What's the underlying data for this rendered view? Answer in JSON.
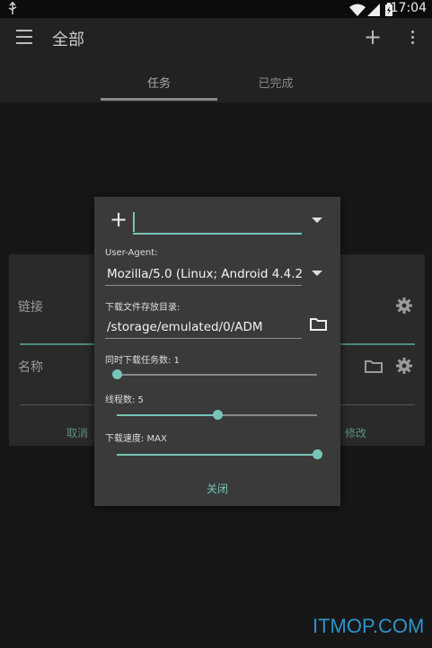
{
  "status_bar": {
    "time": "17:04",
    "usb_icon": "usb-debug-icon",
    "wifi_icon": "wifi-icon",
    "signal_icon": "signal-icon",
    "battery_icon": "battery-icon"
  },
  "toolbar": {
    "title": "全部",
    "menu_icon": "hamburger-menu-icon",
    "add_icon": "plus-icon",
    "more_icon": "overflow-menu-icon"
  },
  "tabs": [
    {
      "label": "任务",
      "active": true
    },
    {
      "label": "已完成",
      "active": false
    }
  ],
  "background_dialog": {
    "link_label": "链接",
    "name_label": "名称",
    "cancel_label": "取消",
    "modify_label": "修改"
  },
  "dialog": {
    "url_prefix_icon": "plus-icon",
    "url_value": "",
    "user_agent_label": "User-Agent:",
    "user_agent_value": "Mozilla/5.0 (Linux; Android 4.4.2;",
    "download_dir_label": "下载文件存放目录:",
    "download_dir_value": "/storage/emulated/0/ADM",
    "concurrent_label": "同时下载任务数: 1",
    "concurrent_value": 1,
    "threads_label": "线程数: 5",
    "threads_value": 5,
    "speed_label": "下载速度: MAX",
    "speed_value": "MAX",
    "close_label": "关闭",
    "accent_color": "#79c4b8"
  },
  "sliders": {
    "concurrent_fraction": 0.0,
    "threads_fraction": 0.5,
    "speed_fraction": 1.0
  },
  "watermark": "ITMOP.COM"
}
